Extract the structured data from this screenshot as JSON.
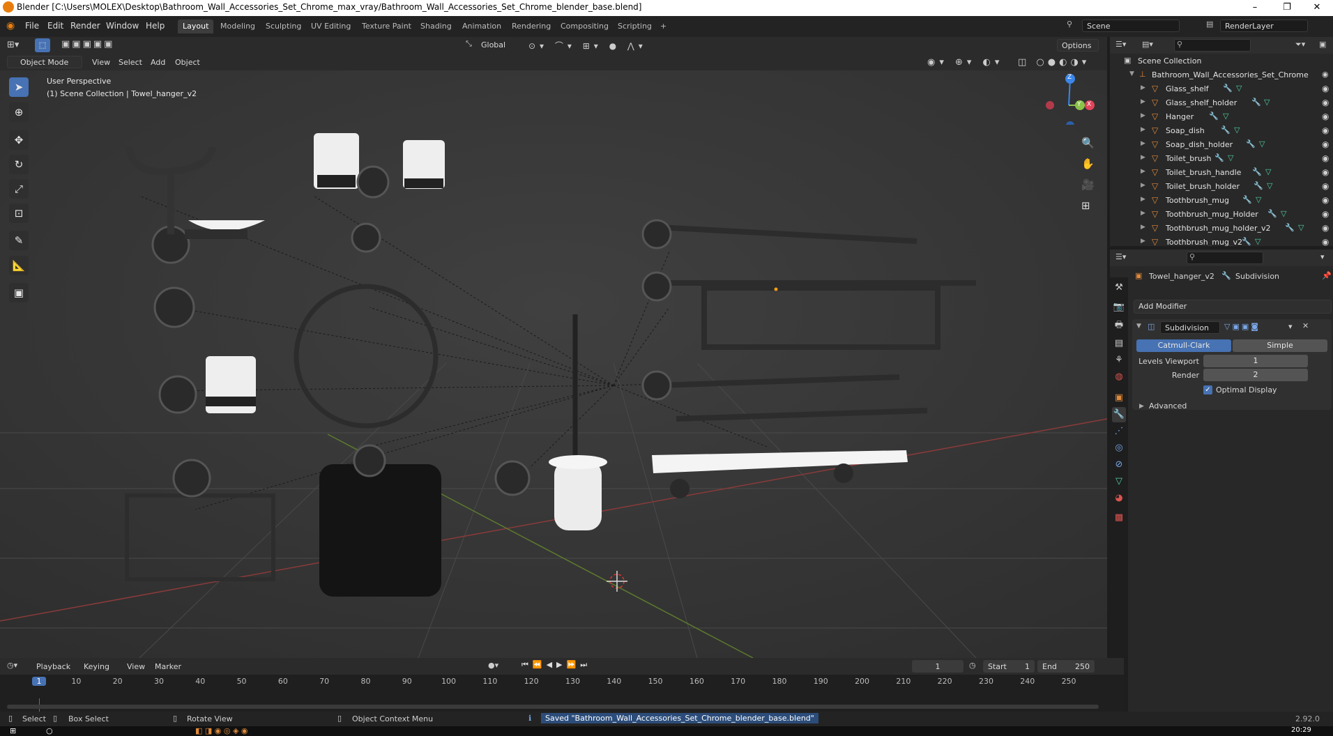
{
  "window": {
    "title": "Blender [C:\\Users\\MOLEX\\Desktop\\Bathroom_Wall_Accessories_Set_Chrome_max_vray/Bathroom_Wall_Accessories_Set_Chrome_blender_base.blend]",
    "minimize": "–",
    "maximize": "❐",
    "close": "✕"
  },
  "menu": [
    "File",
    "Edit",
    "Render",
    "Window",
    "Help"
  ],
  "workspaces": [
    "Layout",
    "Modeling",
    "Sculpting",
    "UV Editing",
    "Texture Paint",
    "Shading",
    "Animation",
    "Rendering",
    "Compositing",
    "Scripting",
    "+"
  ],
  "active_workspace": "Layout",
  "scene": {
    "name": "Scene",
    "view_layer": "RenderLayer"
  },
  "viewport_top": {
    "orientation": "Global",
    "options": "Options"
  },
  "viewport_header": {
    "mode": "Object Mode",
    "menus": [
      "View",
      "Select",
      "Add",
      "Object"
    ]
  },
  "viewport": {
    "perspective": "User Perspective",
    "collection_info": "(1) Scene Collection | Towel_hanger_v2",
    "gizmo": {
      "z": "Z",
      "y": "Y",
      "x": "X"
    },
    "accent_x": "#e2445a",
    "accent_y": "#8bc34a",
    "accent_z": "#3b86e8"
  },
  "outliner": {
    "root": "Scene Collection",
    "collection": "Bathroom_Wall_Accessories_Set_Chrome",
    "items": [
      "Glass_shelf",
      "Glass_shelf_holder",
      "Hanger",
      "Soap_dish",
      "Soap_dish_holder",
      "Toilet_brush",
      "Toilet_brush_handle",
      "Toilet_brush_holder",
      "Toothbrush_mug",
      "Toothbrush_mug_Holder",
      "Toothbrush_mug_holder_v2",
      "Toothbrush_mug_v2"
    ]
  },
  "properties": {
    "object": "Towel_hanger_v2",
    "modifier_ref": "Subdivision",
    "add_modifier": "Add Modifier",
    "modifier": {
      "name": "Subdivision",
      "type_a": "Catmull-Clark",
      "type_b": "Simple",
      "levels_viewport_label": "Levels Viewport",
      "levels_viewport": "1",
      "render_label": "Render",
      "render": "2",
      "optimal_display": "Optimal Display",
      "advanced": "Advanced"
    }
  },
  "timeline": {
    "menus": [
      "Playback",
      "Keying",
      "View",
      "Marker"
    ],
    "current_frame": "1",
    "start_label": "Start",
    "start": "1",
    "end_label": "End",
    "end": "250",
    "ticks": [
      "1",
      "10",
      "20",
      "30",
      "40",
      "50",
      "60",
      "70",
      "80",
      "90",
      "100",
      "110",
      "120",
      "130",
      "140",
      "150",
      "160",
      "170",
      "180",
      "190",
      "200",
      "210",
      "220",
      "230",
      "240",
      "250"
    ]
  },
  "status": {
    "select": "Select",
    "box_select": "Box Select",
    "rotate_view": "Rotate View",
    "context_menu": "Object Context Menu",
    "message": "Saved \"Bathroom_Wall_Accessories_Set_Chrome_blender_base.blend\"",
    "version": "2.92.0"
  },
  "clock": "20:29"
}
